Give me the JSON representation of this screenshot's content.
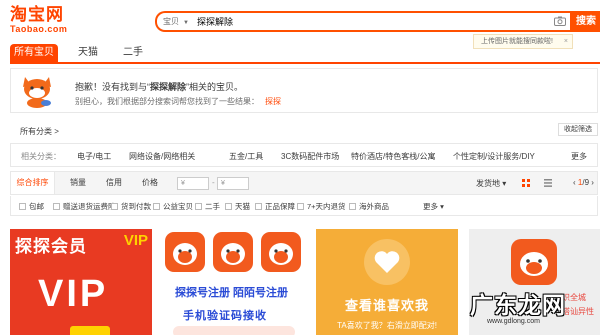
{
  "header": {
    "logo_main": "淘宝网",
    "logo_sub": "Taobao.com",
    "search_scope": "宝贝",
    "search_value": "探探解除",
    "search_button": "搜索",
    "tooltip": "上传图片就能搜同款啦!",
    "tooltip_close": "×"
  },
  "tabs": [
    {
      "label": "所有宝贝",
      "active": true
    },
    {
      "label": "天猫",
      "active": false
    },
    {
      "label": "二手",
      "active": false
    }
  ],
  "notice": {
    "prefix": "抱歉！没有找到与“",
    "keyword": "探探解除",
    "suffix": "”相关的宝贝。",
    "line2": "别担心，我们根据部分搜索词帮您找到了一些结果：",
    "try_word": "探探"
  },
  "breadcrumb": {
    "label": "所有分类",
    "arrow": ">",
    "collapse": "收起筛选"
  },
  "category": {
    "label": "相关分类：",
    "items": [
      "电子/电工",
      "网络设备/网络相关",
      "五金/工具",
      "3C数码配件市场",
      "特价酒店/特色客栈/公寓",
      "个性定制/设计服务/DIY"
    ],
    "more": "更多"
  },
  "sort": {
    "items": [
      "综合排序",
      "销量",
      "信用",
      "价格"
    ],
    "price_from": "¥",
    "price_to": "¥",
    "dash": "-",
    "deliver": "发货地",
    "pager_current": "1",
    "pager_total": "/9"
  },
  "filters": [
    "包邮",
    "赠送退货运费险",
    "货到付款",
    "公益宝贝",
    "二手",
    "天猫",
    "正品保障",
    "7+天内退货",
    "海外商品",
    "更多"
  ],
  "products": {
    "p1_title": "探探会员",
    "p1_tag": "VIP",
    "p1_big": "VIP",
    "p2_line1": "探探号注册 陌陌号注册",
    "p2_line2": "手机验证码接收",
    "p3_title": "查看谁喜欢我",
    "p3_sub": "TA喜欢了我？右滑立即配对!",
    "p4_red1": "识全城",
    "p4_red2": "搭讪异性"
  },
  "watermark": {
    "text": "广东龙网",
    "url": "www.gdlong.com"
  },
  "colors": {
    "brand": "#ff4400",
    "search_border": "#ff5000",
    "link": "#2a4bd6"
  }
}
